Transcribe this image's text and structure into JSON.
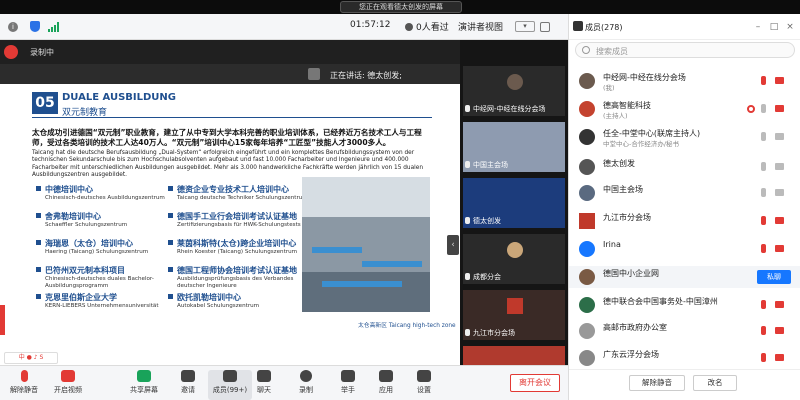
{
  "window": {
    "watching_label": "您正在观看德太创发的屏幕"
  },
  "toolbar": {
    "timer": "01:57:12",
    "viewers": "0人看过",
    "view_mode": "演讲者视图"
  },
  "stage": {
    "recording_label": "录制中",
    "speaking": "正在讲话: 德太创发;",
    "slide": {
      "number": "05",
      "title_en": "DUALE AUSBILDUNG",
      "title_cn": "双元制教育",
      "intro_cn": "太仓成功引进德国“双元制”职业教育，建立了从中专到大学本科完善的职业培训体系，已经养近万名技术工人与工程师，受过各类培训的技术工人达40万人。“双元制”培训中心15家每年培养“工匠型”技能人才3000多人。",
      "intro_en": "Taicang hat die deutsche Berufsausbildung „Dual-System“ erfolgreich eingeführt und ein komplettes Berufsbildungssystem von der technischen Sekundarschule bis zum Hochschulabsolventen aufgebaut und fast 10.000 Facharbeiter und Ingenieure und 400.000 Facharbeiter mit unterschiedlichen Ausbildungen ausgebildet. Mehr als 3.000 handwerkliche Fachkräfte werden jährlich von 15 dualen Ausbildungszentren ausgebildet.",
      "items": [
        {
          "cn": "中德培训中心",
          "en": "Chinesisch-deutsches Ausbildungszentrum"
        },
        {
          "cn": "德资企业专业技术工人培训中心",
          "en": "Taicang deutsche Techniker Schulungszentrum"
        },
        {
          "cn": "舍弗勒培训中心",
          "en": "Schaeffler Schulungszentrum"
        },
        {
          "cn": "德国手工业行会培训考试认证基地",
          "en": "Zertifizierungsbasis für HWK-Schulungstests"
        },
        {
          "cn": "海瑞恩（太仓）培训中心",
          "en": "Haering (Taicang) Schulungszentrum"
        },
        {
          "cn": "莱茵科斯特(太仓)跨企业培训中心",
          "en": "Rhein Koester (Taicang) Schulungszentrum"
        },
        {
          "cn": "巴符州双元制本科项目",
          "en": "Chinesisch-deutsches duales Bachelor-Ausbildungsprogramm"
        },
        {
          "cn": "德国工程师协会培训考试认证基地",
          "en": "Ausbildungsprüfungsbasis des Verbandes deutscher Ingenieure"
        },
        {
          "cn": "克恩里伯斯企业大学",
          "en": "KERN-LIEBERS Unternehmensuniversität"
        },
        {
          "cn": "欧托凯勒培训中心",
          "en": "Autokabel Schulungszentrum"
        }
      ],
      "caption": "太仓高新区 Taicang high-tech zone"
    }
  },
  "videos": [
    {
      "name": "中经网-中经在线分会场"
    },
    {
      "name": "中国主会场"
    },
    {
      "name": "德太创发"
    },
    {
      "name": "成都分会"
    },
    {
      "name": "九江市分会场"
    },
    {
      "name": ""
    }
  ],
  "panel": {
    "title": "成员(278)",
    "search_placeholder": "搜索成员",
    "members": [
      {
        "name": "中经网-中经在线分会场",
        "sub": "(我)",
        "mic": "off",
        "cam": "off"
      },
      {
        "name": "德高智能科技",
        "sub": "(主持人)",
        "mic": "on",
        "cam": "off",
        "rec": true
      },
      {
        "name": "任全-中堂中心(联席主持人)",
        "sub": "中堂中心-合作经济办/秘书",
        "mic": "on",
        "cam": "on"
      },
      {
        "name": "德太创发",
        "sub": "",
        "mic": "on",
        "cam": "on"
      },
      {
        "name": "中国主会场",
        "sub": "",
        "mic": "on",
        "cam": "on"
      },
      {
        "name": "九江市分会场",
        "sub": "",
        "mic": "off",
        "cam": "off"
      },
      {
        "name": "Irina",
        "sub": "",
        "mic": "off",
        "cam": "off"
      },
      {
        "name": "德国中小企业网",
        "sub": "",
        "button": "私聊"
      },
      {
        "name": "德中联合会中国事务处-中国漳州",
        "sub": "",
        "mic": "off",
        "cam": "off"
      },
      {
        "name": "高邮市政府办公室",
        "sub": "",
        "mic": "off",
        "cam": "off"
      },
      {
        "name": "广东云浮分会场",
        "sub": "",
        "mic": "off",
        "cam": "off"
      }
    ],
    "mute_all": "解除静音",
    "rename": "改名"
  },
  "bottombar": {
    "items": [
      {
        "label": "解除静音"
      },
      {
        "label": "开启视频"
      },
      {
        "label": "共享屏幕"
      },
      {
        "label": "邀请"
      },
      {
        "label": "成员(99+)"
      },
      {
        "label": "聊天"
      },
      {
        "label": "录制"
      },
      {
        "label": "举手"
      },
      {
        "label": "应用"
      },
      {
        "label": "设置"
      }
    ],
    "end_label": "离开会议"
  },
  "colors": {
    "accent": "#1677ff",
    "danger": "#e23a35",
    "slide_blue": "#1f4f8f"
  }
}
